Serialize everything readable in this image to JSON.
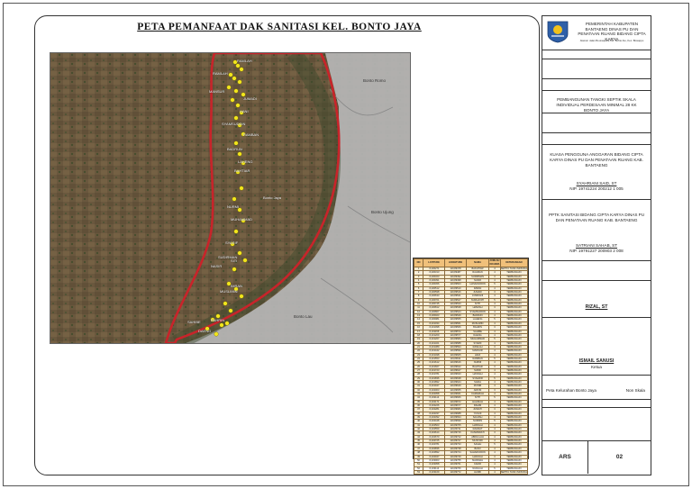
{
  "title": "PETA PEMANFAAT DAK SANITASI KEL. BONTO JAYA",
  "map": {
    "place_labels": [
      "Bonto Romo",
      "Bonto Jaya",
      "Bonto Lau",
      "Bonto Ujung"
    ],
    "point_labels": [
      "RAMLAH",
      "RAMLAH",
      "MANSUR",
      "HANI",
      "SYAMSUDDIN",
      "RAMBAN",
      "BADRUN",
      "LAHENG",
      "BAHTIAR",
      "NURMI",
      "MUHAMMAD",
      "SYARIF",
      "SUDIRMAN",
      "NASIR",
      "IMRAN",
      "MUSLIMIN",
      "BAHRIN",
      "SAHIBE",
      "DAENG",
      "JUMADI",
      "SITI"
    ],
    "colors": {
      "boundary": "#c8242a",
      "points": "#f2e61c",
      "terrain": "#6d5a40",
      "light_area": "#b8b8b8"
    }
  },
  "table": {
    "columns": [
      "NO",
      "LATITUDE",
      "LONGITUDE",
      "NAMA",
      "JUMLAH KK/JIWA",
      "KETERANGAN"
    ],
    "rows": [
      [
        "1",
        "-5,230271",
        "119,89478",
        "BAKHTIAR",
        "4",
        "SEPTIC TANK INDIVIDUAL"
      ],
      [
        "2",
        "-5,230313",
        "119,89487",
        "RAHMAN",
        "4",
        "TERBANGUN"
      ],
      [
        "3",
        "-5,230323",
        "119,89492",
        "SUDIRMAN",
        "3",
        "TERBANGUN"
      ],
      [
        "4",
        "-5,230391",
        "119,89498",
        "NASIR",
        "4",
        "TERBANGUN"
      ],
      [
        "5",
        "-5,230456",
        "119,89503",
        "HASANUDDIN",
        "5",
        "TERBANGUN"
      ],
      [
        "6",
        "-5,230512",
        "119,89510",
        "IMRAN",
        "4",
        "TERBANGUN"
      ],
      [
        "7",
        "-5,230598",
        "119,89516",
        "JUMADI",
        "3",
        "TERBANGUN"
      ],
      [
        "8",
        "-5,230633",
        "119,89521",
        "JUMRIANI",
        "4",
        "TERBANGUN"
      ],
      [
        "9",
        "-5,230701",
        "119,89527",
        "NURHAYATI",
        "5",
        "TERBANGUN"
      ],
      [
        "10",
        "-5,230745",
        "119,89533",
        "SITTI",
        "4",
        "TERBANGUN"
      ],
      [
        "11",
        "-5,230812",
        "119,89538",
        "HAMZAH",
        "3",
        "TERBANGUN"
      ],
      [
        "12",
        "-5,230867",
        "119,89544",
        "SYAMSUDDIN",
        "4",
        "TERBANGUN"
      ],
      [
        "13",
        "-5,230923",
        "119,89549",
        "BADRUN",
        "4",
        "TERBANGUN"
      ],
      [
        "14",
        "-5,230981",
        "119,89555",
        "LAHENG",
        "5",
        "TERBANGUN"
      ],
      [
        "15",
        "-5,231034",
        "119,89561",
        "MUSLIMIN",
        "4",
        "TERBANGUN"
      ],
      [
        "16",
        "-5,231098",
        "119,89566",
        "BAHRIN",
        "3",
        "TERBANGUN"
      ],
      [
        "17",
        "-5,231156",
        "119,89572",
        "SAHIBE",
        "4",
        "TERBANGUN"
      ],
      [
        "18",
        "-5,231209",
        "119,89577",
        "DAENG",
        "4",
        "TERBANGUN"
      ],
      [
        "19",
        "-5,231267",
        "119,89583",
        "MUHAMMAD",
        "5",
        "TERBANGUN"
      ],
      [
        "20",
        "-5,231321",
        "119,89588",
        "SYARIF",
        "4",
        "TERBANGUN"
      ],
      [
        "21",
        "-5,231389",
        "119,89594",
        "RAMLAH",
        "3",
        "TERBANGUN"
      ],
      [
        "22",
        "-5,231442",
        "119,89599",
        "MANSUR",
        "4",
        "TERBANGUN"
      ],
      [
        "23",
        "-5,231498",
        "119,89605",
        "HANI",
        "4",
        "TERBANGUN"
      ],
      [
        "24",
        "-5,231553",
        "119,89611",
        "RAMBAN",
        "5",
        "TERBANGUN"
      ],
      [
        "25",
        "-5,231612",
        "119,89616",
        "NURMI",
        "4",
        "TERBANGUN"
      ],
      [
        "26",
        "-5,231667",
        "119,89622",
        "BAHTIAR",
        "3",
        "TERBANGUN"
      ],
      [
        "27",
        "-5,231723",
        "119,89627",
        "SUKRI",
        "4",
        "TERBANGUN"
      ],
      [
        "28",
        "-5,231781",
        "119,89633",
        "HASNAH",
        "4",
        "TERBANGUN"
      ],
      [
        "29",
        "-5,231836",
        "119,89638",
        "SYAHRIR",
        "5",
        "TERBANGUN"
      ],
      [
        "30",
        "-5,231892",
        "119,89644",
        "SAIDA",
        "4",
        "TERBANGUN"
      ],
      [
        "31",
        "-5,231947",
        "119,89649",
        "MUNIR",
        "4",
        "TERBANGUN"
      ],
      [
        "32",
        "-5,232003",
        "119,89655",
        "ARIFIN",
        "3",
        "TERBANGUN"
      ],
      [
        "33",
        "-5,232058",
        "119,89661",
        "KAMARIAH",
        "4",
        "TERBANGUN"
      ],
      [
        "34",
        "-5,232114",
        "119,89666",
        "SITTI",
        "5",
        "TERBANGUN"
      ],
      [
        "35",
        "-5,232171",
        "119,89672",
        "HALIMAH",
        "4",
        "TERBANGUN"
      ],
      [
        "36",
        "-5,232226",
        "119,89677",
        "RAHIM",
        "4",
        "TERBANGUN"
      ],
      [
        "37",
        "-5,232281",
        "119,89683",
        "JUMIATI",
        "3",
        "TERBANGUN"
      ],
      [
        "38",
        "-5,232337",
        "119,89688",
        "YUSUF",
        "4",
        "TERBANGUN"
      ],
      [
        "39",
        "-5,232392",
        "119,89694",
        "SALMAH",
        "4",
        "TERBANGUN"
      ],
      [
        "40",
        "-5,232448",
        "119,89699",
        "NURDIN",
        "5",
        "TERBANGUN"
      ],
      [
        "41",
        "-5,232503",
        "119,89705",
        "HAMSAH",
        "4",
        "TERBANGUN"
      ],
      [
        "42",
        "-5,232559",
        "119,89711",
        "RAHMAT",
        "4",
        "TERBANGUN"
      ],
      [
        "43",
        "-5,232614",
        "119,89716",
        "KASMAWATI",
        "3",
        "TERBANGUN"
      ],
      [
        "44",
        "-5,232670",
        "119,89722",
        "ABDULLAH",
        "4",
        "TERBANGUN"
      ],
      [
        "45",
        "-5,232725",
        "119,89727",
        "MUSTARI",
        "4",
        "TERBANGUN"
      ],
      [
        "46",
        "-5,232781",
        "119,89733",
        "SALEH",
        "5",
        "TERBANGUN"
      ],
      [
        "47",
        "-5,232836",
        "119,89738",
        "BASO",
        "4",
        "TERBANGUN"
      ],
      [
        "48",
        "-5,232892",
        "119,89744",
        "SAHARUDDIN",
        "4",
        "TERBANGUN"
      ],
      [
        "49",
        "-5,232947",
        "119,89749",
        "HADIJAH",
        "3",
        "TERBANGUN"
      ],
      [
        "50",
        "-5,233003",
        "119,89755",
        "MARDIAH",
        "4",
        "TERBANGUN"
      ],
      [
        "51",
        "-5,233058",
        "119,89761",
        "KADIR",
        "4",
        "TERBANGUN"
      ],
      [
        "52",
        "-5,233114",
        "119,89766",
        "NURLIAH",
        "5",
        "TERBANGUN"
      ],
      [
        "53",
        "-5,233169",
        "119,89772",
        "HASBI",
        "4",
        "SEPTIC TANK INDIVIDUAL"
      ]
    ]
  },
  "panel": {
    "header_org": "PEMERINTAH KABUPATEN BANTAENG DINAS PU DAN PENATAAN RUANG BIDANG CIPTA KARYA",
    "header_address": "Alamat: Jalan Bouraquella Kel. Bonto Atu, Kec. Bissappu",
    "project": "PEMBANGUNAN TANGKI SEPTIK SKALA INDIVIDUAL PERDESAAN MINIMAL 28 KK BONTO JAYA",
    "kpa_title": "KUASA PENGGUNA ANGGARAN BIDANG CIPTA KARYA DINAS PU DAN PENATAAN RUANG KAB. BANTAENG",
    "kpa_name": "SYAHRIANI SAID, ST",
    "kpa_nip": "NIP. 19741224 200212 1 005",
    "pptk_title": "PPTK SANITASI BIDANG CIPTA KARYA DINAS PU DAN PENATAAN RUANG KAB. BANTAENG",
    "pptk_name": "SATRIANI SAHAB, ST",
    "pptk_nip": "NIP. 19791227 200903 2 008",
    "drafter": "RIZAL, ST",
    "checker_name": "ISMAIL SANUSI",
    "checker_role": "Ketua",
    "map_title": "Peta Kelurahan Bonto Jaya",
    "scale": "Non Skala",
    "code": "ARS",
    "sheet": "02"
  }
}
